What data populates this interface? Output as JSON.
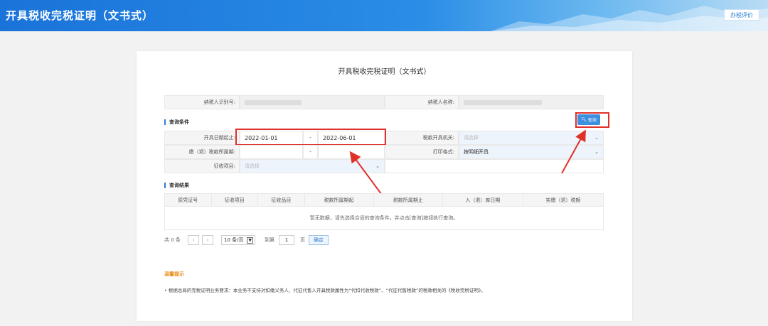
{
  "header": {
    "title": "开具税收完税证明（文书式）",
    "eval_button": "办税评价"
  },
  "form": {
    "title": "开具税收完税证明（文书式）",
    "taxpayer_id_label": "纳税人识别号:",
    "taxpayer_name_label": "纳税人名称:",
    "query_section": "查询条件",
    "date_label": "开具日期起止:",
    "date_from": "2022-01-01",
    "date_sep": "-",
    "date_to": "2022-06-01",
    "authority_label": "税款开具机关:",
    "authority_placeholder": "请选择",
    "period_label": "缴（退）税款所属期:",
    "period_sep": "-",
    "print_label": "打印格式:",
    "print_value": "按明细开具",
    "item_label": "征收项目:",
    "item_placeholder": "请选择",
    "query_button": "查询"
  },
  "results": {
    "section": "查询结果",
    "columns": [
      "原凭证号",
      "征收项目",
      "征收品目",
      "税款所属期起",
      "税款所属期止",
      "入（退）库日期",
      "实缴（退）税额"
    ],
    "empty_message": "暂无数据，请先选择合适的查询条件，并点击[查询]按钮执行查询。"
  },
  "pager": {
    "total": "共 0 条",
    "page_size": "10 条/页",
    "goto_label": "到第",
    "page_num": "1",
    "page_unit": "页",
    "confirm": "确定"
  },
  "tips": {
    "head": "温馨提示",
    "text": "• 根据总局的完税证明业务要求：本业务不支持对扣缴义务人、代征代售人开具税款属性为“代扣代收税款”、“代征代售税款”的税款相关的《税收完税证明》。"
  },
  "colors": {
    "accent": "#2a7bd6",
    "highlight": "#e0302a",
    "tip": "#e8901a"
  }
}
